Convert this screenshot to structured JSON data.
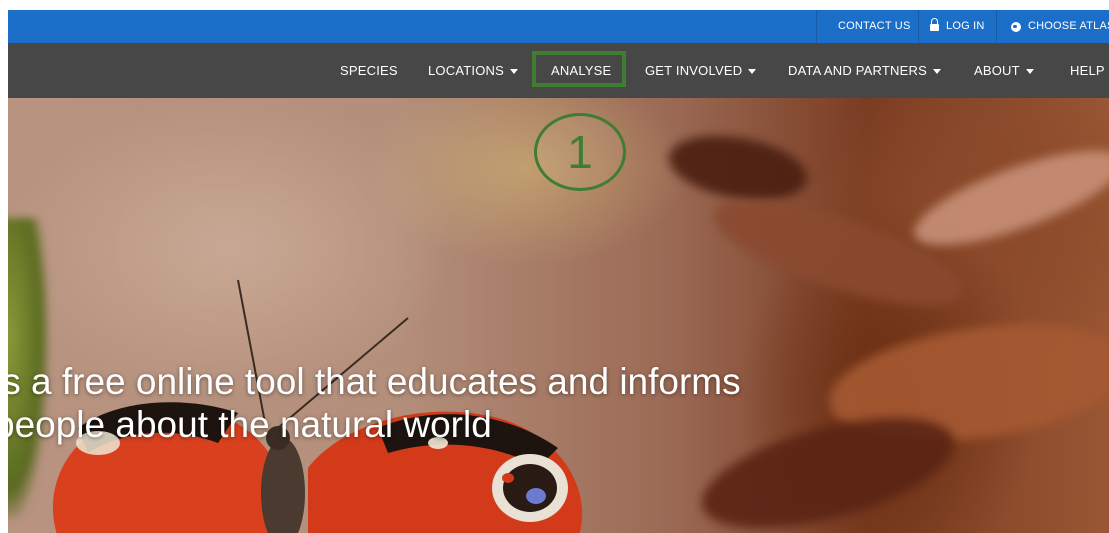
{
  "topbar": {
    "contact": "CONTACT US",
    "login": "LOG IN",
    "choose_atlas": "CHOOSE ATLAS"
  },
  "nav": {
    "species": "SPECIES",
    "locations": "LOCATIONS",
    "analyse": "ANALYSE",
    "get_involved": "GET INVOLVED",
    "data_partners": "DATA AND PARTNERS",
    "about": "ABOUT",
    "help": "HELP"
  },
  "hero": {
    "line1": "is a free online tool that educates and informs",
    "line2": "people about the natural world"
  },
  "annotation": {
    "step": "1",
    "color": "#3f7e32"
  },
  "colors": {
    "topbar": "#1b6fc9",
    "navbar": "#474747"
  }
}
